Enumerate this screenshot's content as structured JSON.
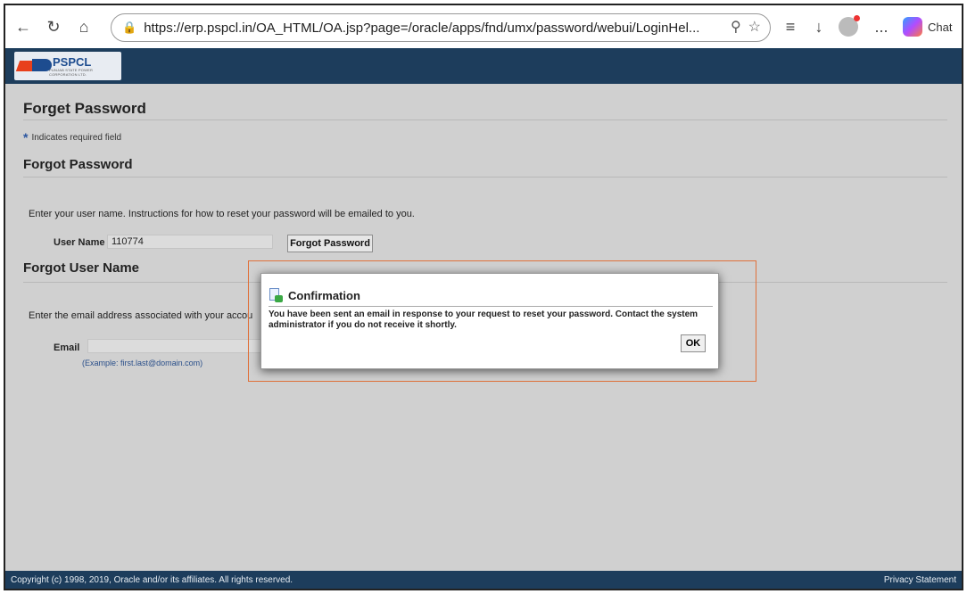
{
  "browser": {
    "url": "https://erp.pspcl.in/OA_HTML/OA.jsp?page=/oracle/apps/fnd/umx/password/webui/LoginHel...",
    "chat_label": "Chat",
    "more_label": "..."
  },
  "brand": {
    "logo_text": "PSPCL",
    "logo_sub": "PUNJAB STATE POWER CORPORATION LTD."
  },
  "page": {
    "title": "Forget Password",
    "required_note": "Indicates required field",
    "forgot_password": {
      "heading": "Forgot Password",
      "instructions": "Enter your user name. Instructions for how to reset your password will be emailed to you.",
      "username_label": "User Name",
      "username_value": "110774",
      "submit_label": "Forgot Password"
    },
    "forgot_username": {
      "heading": "Forgot User Name",
      "instructions": "Enter the email address associated with your accou",
      "email_label": "Email",
      "email_value": "",
      "example": "(Example: first.last@domain.com)"
    }
  },
  "dialog": {
    "title": "Confirmation",
    "message": "You have been sent an email in response to your request to reset your password. Contact the system administrator if you do not receive it shortly.",
    "ok_label": "OK"
  },
  "footer": {
    "copyright": "Copyright (c) 1998, 2019, Oracle and/or its affiliates. All rights reserved.",
    "privacy": "Privacy Statement"
  }
}
